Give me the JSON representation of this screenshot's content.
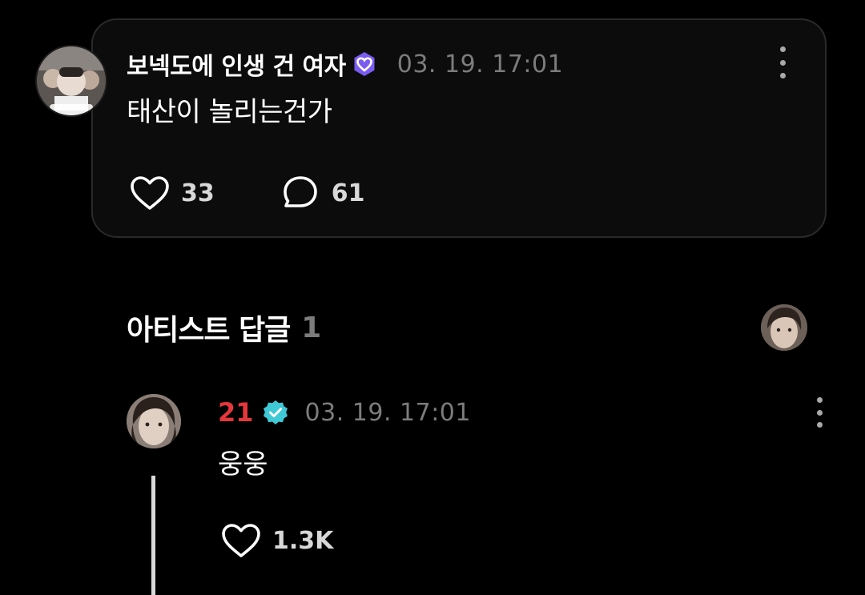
{
  "post": {
    "author": "보넥도에 인생 건 여자",
    "author_badge_icon": "heart-badge-icon",
    "timestamp": "03. 19. 17:01",
    "text": "태산이 놀리는건가",
    "likes": "33",
    "comments": "61",
    "like_icon": "heart-outline-icon",
    "comment_icon": "speech-bubble-icon",
    "more_icon": "more-vertical-icon"
  },
  "artist_replies": {
    "title": "아티스트 답글",
    "count": "1"
  },
  "reply": {
    "author": "21",
    "author_color": "#e5373c",
    "verified_icon": "verified-check-icon",
    "timestamp": "03. 19. 17:01",
    "text": "웅웅",
    "likes": "1.3K",
    "like_icon": "heart-outline-icon",
    "more_icon": "more-vertical-icon"
  },
  "colors": {
    "background": "#000000",
    "card_background": "#0c0c0c",
    "card_border": "#2a2a2a",
    "muted_text": "#7c7c7c",
    "badge_purple": "#7b5cf0",
    "verified_cyan": "#3fc8d6"
  }
}
